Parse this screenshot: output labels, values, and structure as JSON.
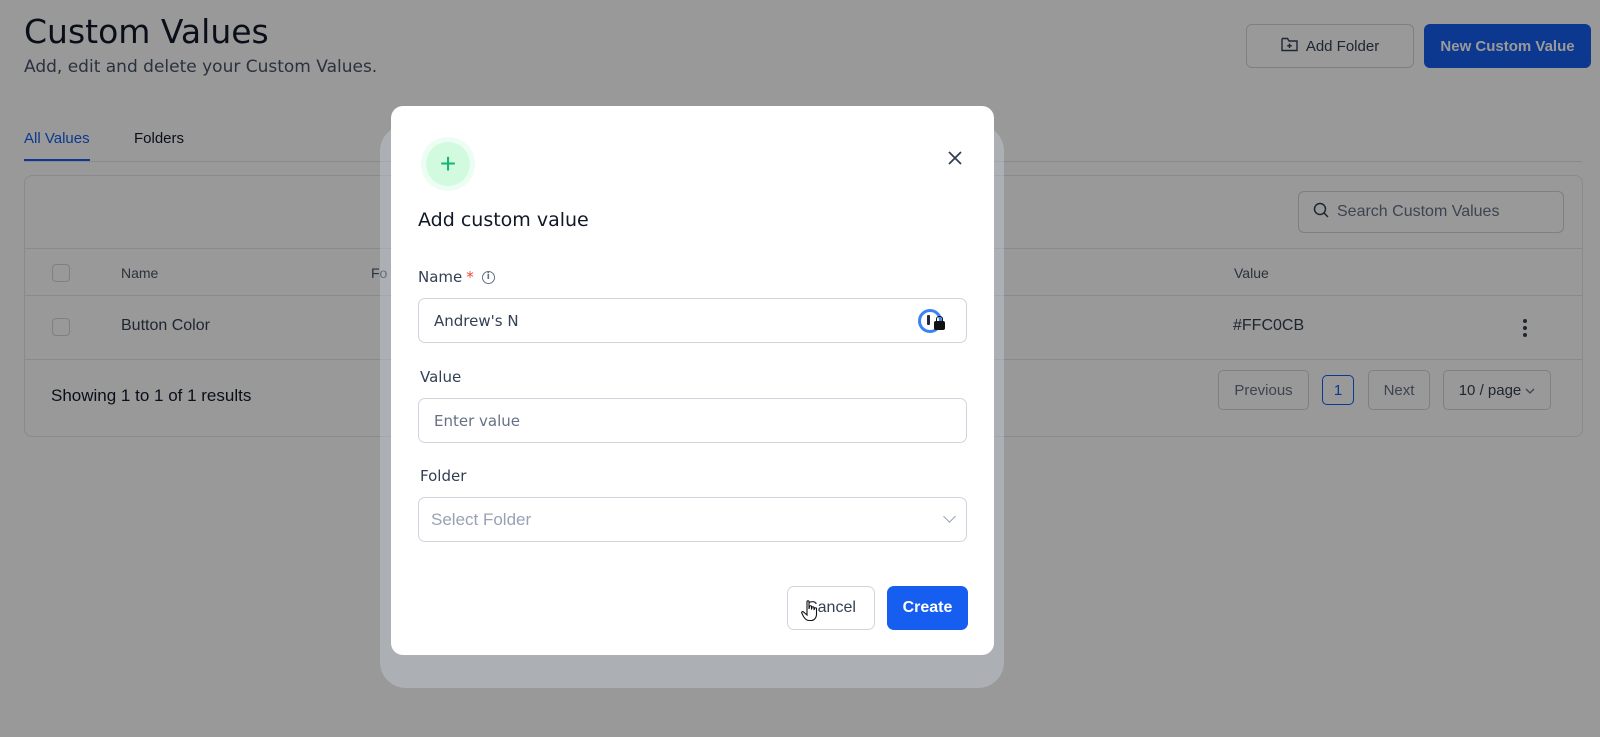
{
  "page": {
    "title": "Custom Values",
    "subtitle": "Add, edit and delete your Custom Values."
  },
  "header": {
    "add_folder_label": "Add Folder",
    "new_value_label": "New Custom Value"
  },
  "tabs": [
    {
      "label": "All Values",
      "active": true
    },
    {
      "label": "Folders",
      "active": false
    }
  ],
  "search": {
    "placeholder": "Search Custom Values"
  },
  "table": {
    "columns": [
      "Name",
      "Fo",
      "Value"
    ],
    "rows": [
      {
        "name": "Button Color",
        "value": "#FFC0CB"
      }
    ]
  },
  "footer": {
    "showing": "Showing 1 to 1 of 1 results",
    "previous": "Previous",
    "page": "1",
    "next": "Next",
    "page_size": "10 / page"
  },
  "modal": {
    "title": "Add custom value",
    "name_label": "Name",
    "required_mark": "*",
    "name_value": "Andrew's N",
    "value_label": "Value",
    "value_placeholder": "Enter value",
    "folder_label": "Folder",
    "folder_placeholder": "Select Folder",
    "cancel_label": "Cancel",
    "create_label": "Create"
  },
  "colors": {
    "primary": "#155eef",
    "success_icon": "#12b76a",
    "required": "#f04438"
  }
}
